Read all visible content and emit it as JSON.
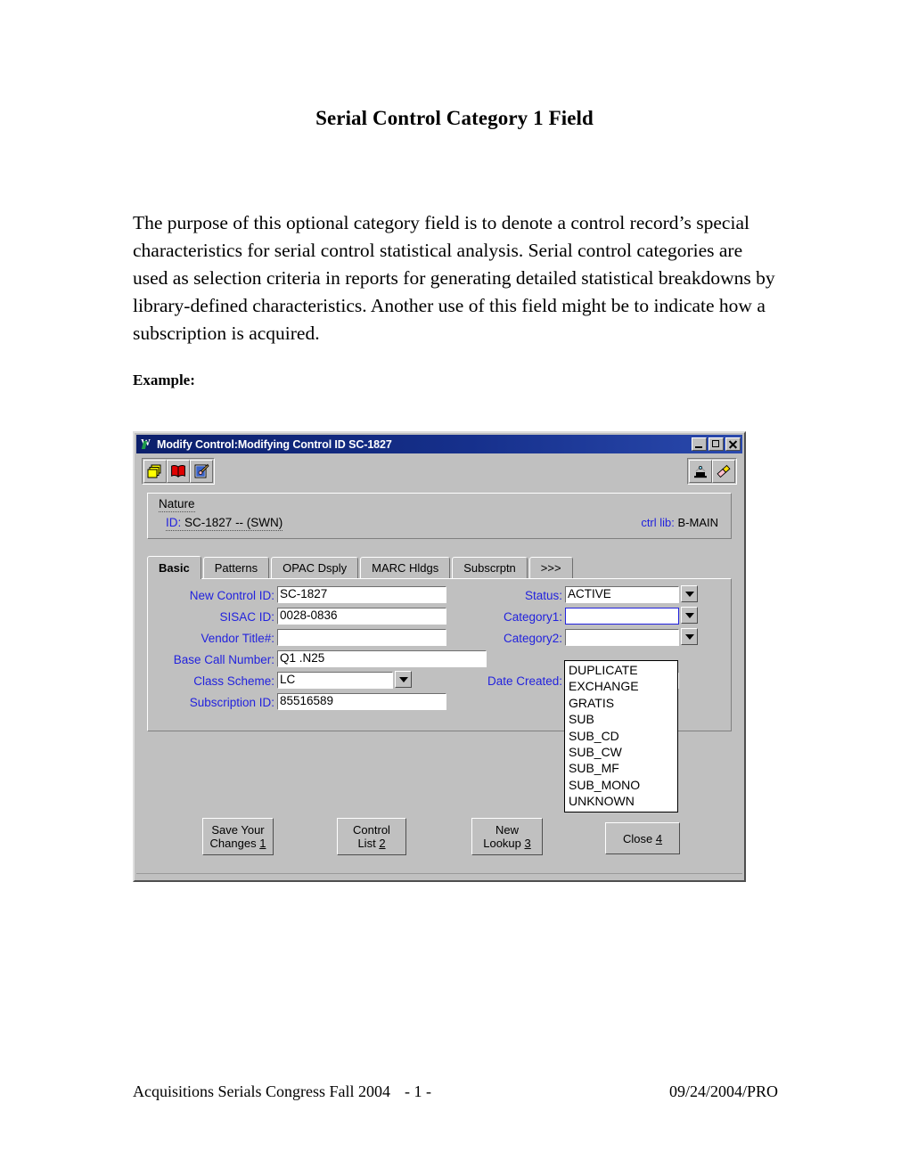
{
  "document": {
    "title": "Serial Control Category 1 Field",
    "body": "The purpose of this optional category field is to denote a control record’s special characteristics for serial control statistical analysis.  Serial control categories are used as selection criteria in reports for generating detailed statistical breakdowns by library-defined characteristics.  Another use of this field might be to indicate how a subscription is acquired.",
    "example_label": "Example:",
    "footer": {
      "left": "Acquisitions Serials Congress Fall 2004",
      "page": "- 1 -",
      "right": "09/24/2004/PRO"
    }
  },
  "window": {
    "title": "Modify Control:Modifying Control ID SC-1827",
    "controls": {
      "minimize": "minimize-button",
      "maximize": "maximize-button",
      "close": "close-button"
    },
    "toolbar": {
      "left_icons": [
        "copy-records-icon",
        "open-book-icon",
        "edit-note-icon"
      ],
      "right_icons": [
        "magic-hat-icon",
        "eraser-pencil-icon"
      ]
    },
    "nature": {
      "legend": "Nature",
      "id_key": "ID:",
      "id_value": "SC-1827 -- (SWN)",
      "ctrl_lib_key": "ctrl lib:",
      "ctrl_lib_value": "B-MAIN"
    },
    "tabs": [
      {
        "label": "Basic",
        "active": true
      },
      {
        "label": "Patterns",
        "active": false
      },
      {
        "label": "OPAC Dsply",
        "active": false
      },
      {
        "label": "MARC Hldgs",
        "active": false
      },
      {
        "label": "Subscrptn",
        "active": false
      },
      {
        "label": ">>>",
        "active": false
      }
    ],
    "fields": {
      "new_control_id": {
        "label": "New Control ID:",
        "value": "SC-1827"
      },
      "sisac_id": {
        "label": "SISAC ID:",
        "value": "0028-0836"
      },
      "vendor_title": {
        "label": "Vendor Title#:",
        "value": ""
      },
      "base_call_number": {
        "label": "Base Call Number:",
        "value": "Q1 .N25"
      },
      "class_scheme": {
        "label": "Class Scheme:",
        "value": "LC"
      },
      "subscription_id": {
        "label": "Subscription ID:",
        "value": "85516589"
      },
      "status": {
        "label": "Status:",
        "value": "ACTIVE"
      },
      "category1": {
        "label": "Category1:",
        "value": ""
      },
      "category2": {
        "label": "Category2:",
        "value": ""
      },
      "date_created": {
        "label": "Date Created:",
        "value": ""
      }
    },
    "category1_options": [
      "DUPLICATE",
      "EXCHANGE",
      "GRATIS",
      "SUB",
      "SUB_CD",
      "SUB_CW",
      "SUB_MF",
      "SUB_MONO",
      "UNKNOWN"
    ],
    "buttons": [
      {
        "line1": "Save Your",
        "line2": "Changes",
        "accel": "1"
      },
      {
        "line1": "Control",
        "line2": "List",
        "accel": "2"
      },
      {
        "line1": "New",
        "line2": "Lookup",
        "accel": "3"
      },
      {
        "line1": "Close",
        "line2": "",
        "accel": "4"
      }
    ],
    "colors": {
      "titlebar": "#16308c",
      "face": "#c0c0c0",
      "label_blue": "#2222dd",
      "focus_blue": "#2222dd"
    }
  }
}
